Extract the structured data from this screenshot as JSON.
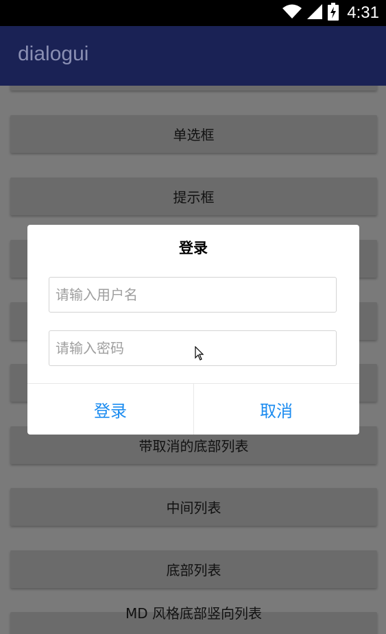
{
  "status_bar": {
    "time": "4:31",
    "icons": [
      "wifi-icon",
      "signal-icon",
      "battery-icon"
    ]
  },
  "app_bar": {
    "title": "dialogui"
  },
  "list": {
    "items": [
      {
        "label": ""
      },
      {
        "label": "单选框"
      },
      {
        "label": "提示框"
      },
      {
        "label": ""
      },
      {
        "label": ""
      },
      {
        "label": ""
      },
      {
        "label": "带取消的底部列表"
      },
      {
        "label": "中间列表"
      },
      {
        "label": "底部列表"
      },
      {
        "label": "MD 风格底部竖向列表"
      }
    ]
  },
  "dialog": {
    "title": "登录",
    "username_placeholder": "请输入用户名",
    "password_placeholder": "请输入密码",
    "confirm_label": "登录",
    "cancel_label": "取消"
  },
  "colors": {
    "app_bar": "#1a2255",
    "accent": "#1a8bf0",
    "scrim_background": "#7a7a7a"
  }
}
